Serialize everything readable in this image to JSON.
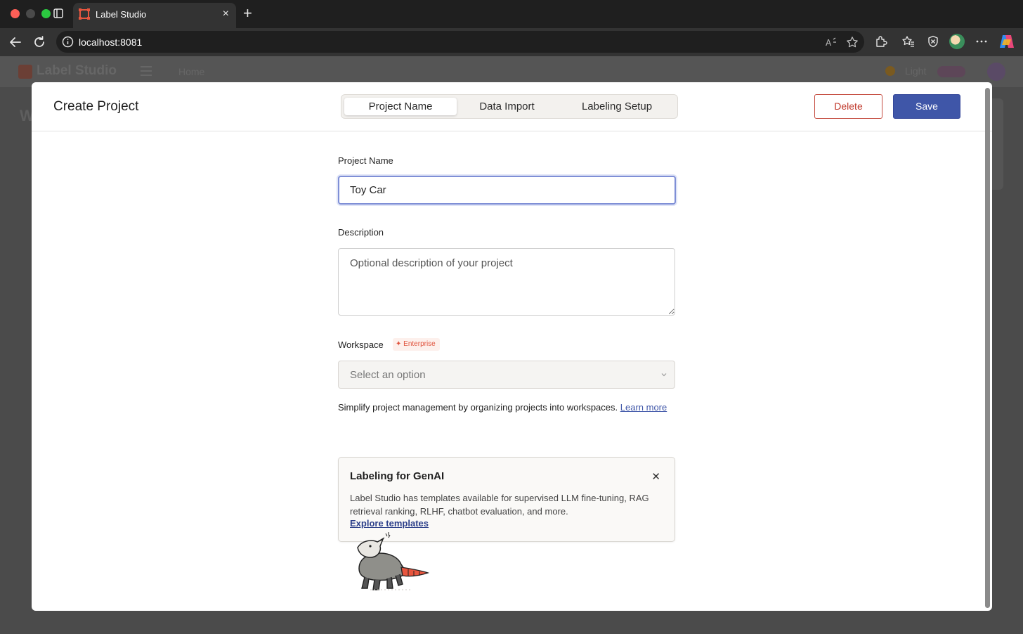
{
  "browser": {
    "tab_title": "Label Studio",
    "url": "localhost:8081"
  },
  "background_app": {
    "brand": "Label Studio",
    "nav_home": "Home",
    "theme": "Light"
  },
  "modal": {
    "title": "Create Project",
    "steps": [
      {
        "label": "Project Name",
        "active": true
      },
      {
        "label": "Data Import",
        "active": false
      },
      {
        "label": "Labeling Setup",
        "active": false
      }
    ],
    "delete_label": "Delete",
    "save_label": "Save"
  },
  "form": {
    "project_name_label": "Project Name",
    "project_name_value": "Toy Car",
    "description_label": "Description",
    "description_placeholder": "Optional description of your project",
    "workspace_label": "Workspace",
    "enterprise_badge": "Enterprise",
    "workspace_placeholder": "Select an option",
    "help_text": "Simplify project management by organizing projects into workspaces. ",
    "help_link": "Learn more"
  },
  "genai_card": {
    "title": "Labeling for GenAI",
    "body": "Label Studio has templates available for supervised LLM fine-tuning, RAG retrieval ranking, RLHF, chatbot evaluation, and more.",
    "link": "Explore templates"
  },
  "colors": {
    "accent": "#3f56a8",
    "danger": "#c0392b",
    "enterprise": "#e0533d",
    "brand": "#e8563f"
  }
}
